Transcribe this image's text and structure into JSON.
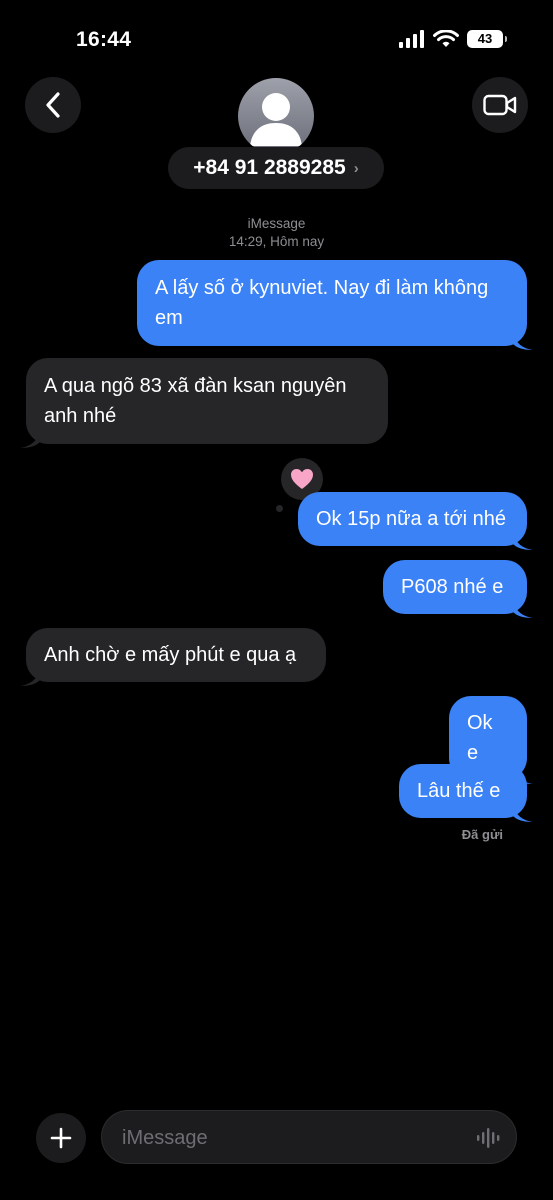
{
  "status_bar": {
    "time": "16:44",
    "battery": "43"
  },
  "header": {
    "contact": "+84 91 2889285",
    "chevron": "›"
  },
  "thread": {
    "service": "iMessage",
    "timestamp": "14:29, Hôm nay",
    "messages": [
      {
        "direction": "outgoing",
        "text": "A lấy số ở kynuviet. Nay đi làm không em"
      },
      {
        "direction": "incoming",
        "text": "A qua ngõ 83 xã đàn ksan nguyên anh nhé"
      },
      {
        "direction": "outgoing",
        "text": "Ok 15p nữa a tới nhé",
        "reaction": "pink-heart"
      },
      {
        "direction": "outgoing",
        "text": "P608 nhé e"
      },
      {
        "direction": "incoming",
        "text": "Anh chờ e mấy phút e qua ạ"
      },
      {
        "direction": "outgoing",
        "text": "Ok e"
      },
      {
        "direction": "outgoing",
        "text": "Lâu thế e"
      }
    ],
    "delivered_label": "Đã gửi"
  },
  "composer": {
    "placeholder": "iMessage"
  },
  "colors": {
    "outgoing": "#3b82f6",
    "incoming": "#262628",
    "background": "#000000"
  },
  "icons": [
    "back-chevron-icon",
    "video-camera-icon",
    "person-icon",
    "plus-icon",
    "waveform-icon",
    "heart-icon",
    "wifi-icon",
    "signal-icon"
  ]
}
